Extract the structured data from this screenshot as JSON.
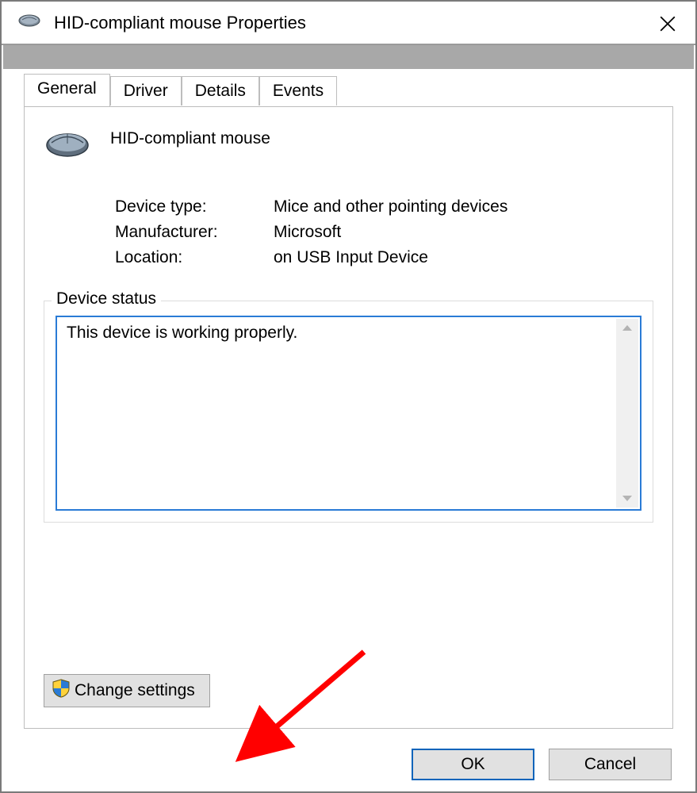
{
  "window": {
    "title": "HID-compliant mouse Properties"
  },
  "tabs": [
    {
      "label": "General",
      "active": true
    },
    {
      "label": "Driver",
      "active": false
    },
    {
      "label": "Details",
      "active": false
    },
    {
      "label": "Events",
      "active": false
    }
  ],
  "device": {
    "name": "HID-compliant mouse",
    "icon": "mouse-icon",
    "properties": {
      "device_type_label": "Device type:",
      "device_type_value": "Mice and other pointing devices",
      "manufacturer_label": "Manufacturer:",
      "manufacturer_value": "Microsoft",
      "location_label": "Location:",
      "location_value": "on USB Input Device"
    }
  },
  "status": {
    "legend": "Device status",
    "text": "This device is working properly."
  },
  "buttons": {
    "change_settings": "Change settings",
    "ok": "OK",
    "cancel": "Cancel"
  },
  "annotation": {
    "color": "#ff0000"
  }
}
